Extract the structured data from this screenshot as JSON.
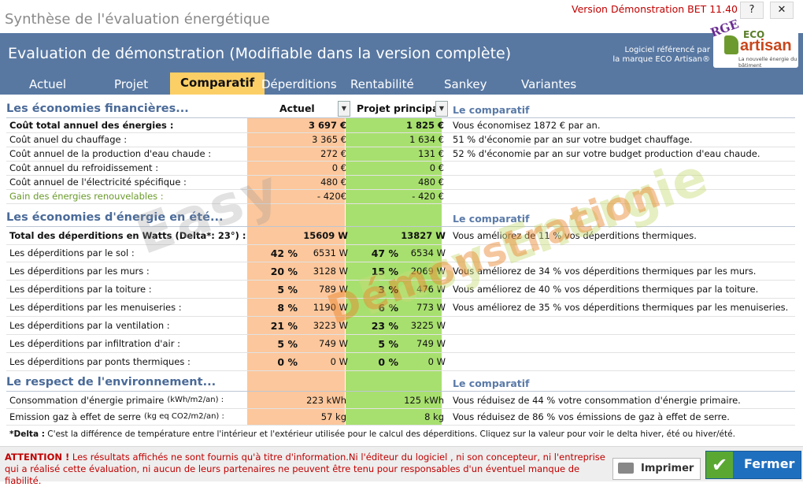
{
  "window": {
    "title": "Synthèse de l'évaluation énergétique",
    "version": "Version Démonstration BET 11.40",
    "help": "?",
    "close": "✕"
  },
  "header": {
    "title": "Evaluation de démonstration (Modifiable dans la version complète)",
    "ref_line1": "Logiciel référencé par",
    "ref_line2": "la marque ECO Artisan®",
    "logo": {
      "rge": "RGE",
      "eco": "ECO",
      "artisan": "artisan",
      "tagline": "La nouvelle énergie du bâtiment"
    }
  },
  "tabs": [
    {
      "label": "Actuel"
    },
    {
      "label": "Projet"
    },
    {
      "label": "Comparatif",
      "active": true
    },
    {
      "label": "Déperditions"
    },
    {
      "label": "Rentabilité"
    },
    {
      "label": "Sankey"
    },
    {
      "label": "Variantes"
    }
  ],
  "columns": {
    "actuel": "Actuel",
    "projet": "Projet principal",
    "comparatif": "Le comparatif"
  },
  "finance": {
    "title": "Les économies financières...",
    "rows": [
      {
        "label": "Coût total annuel des énergies :",
        "a": "3 697 €",
        "b": "1 825 €",
        "note": "Vous économisez 1872 € par an."
      },
      {
        "label": "Coût anuel du chauffage :",
        "a": "3 365 €",
        "b": "1 634 €",
        "note": "51 % d'économie par an sur votre budget chauffage."
      },
      {
        "label": "Coût annuel de la production d'eau chaude :",
        "a": "272 €",
        "b": "131 €",
        "note": "52 % d'économie par an sur votre budget production d'eau chaude."
      },
      {
        "label": "Coût annuel du refroidissement :",
        "a": "0 €",
        "b": "0 €",
        "note": ""
      },
      {
        "label": "Coût annuel de l'électricité spécifique :",
        "a": "480 €",
        "b": "480 €",
        "note": ""
      },
      {
        "label": "Gain des énergies renouvelables :",
        "a": "- 420€",
        "b": "- 420 €",
        "note": ""
      }
    ]
  },
  "energy": {
    "title": "Les économies d'énergie en été...",
    "rows": [
      {
        "label": "Total des déperditions en Watts (Delta*: 23°) :",
        "pa": "",
        "a": "15609 W",
        "pb": "",
        "b": "13827 W",
        "note": "Vous améliorez de 11 % vos déperditions thermiques."
      },
      {
        "label": "Les déperditions par le sol :",
        "pa": "42 %",
        "a": "6531 W",
        "pb": "47 %",
        "b": "6534 W",
        "note": ""
      },
      {
        "label": "Les déperditions par les murs :",
        "pa": "20 %",
        "a": "3128 W",
        "pb": "15 %",
        "b": "2069 W",
        "note": "Vous améliorez de 34 % vos déperditions thermiques par les murs."
      },
      {
        "label": "Les déperditions par la toiture :",
        "pa": "5 %",
        "a": "789 W",
        "pb": "3 %",
        "b": "476 W",
        "note": "Vous améliorez de 40 % vos déperditions thermiques par la toiture."
      },
      {
        "label": "Les déperditions par les menuiseries :",
        "pa": "8 %",
        "a": "1190 W",
        "pb": "6 %",
        "b": "773 W",
        "note": "Vous améliorez de 35 % vos déperditions thermiques par les menuiseries."
      },
      {
        "label": "Les déperditions par la ventilation :",
        "pa": "21 %",
        "a": "3223 W",
        "pb": "23 %",
        "b": "3225 W",
        "note": ""
      },
      {
        "label": "Les déperditions par infiltration d'air :",
        "pa": "5 %",
        "a": "749 W",
        "pb": "5 %",
        "b": "749 W",
        "note": ""
      },
      {
        "label": "Les déperditions par ponts thermiques :",
        "pa": "0 %",
        "a": "0 W",
        "pb": "0 %",
        "b": "0 W",
        "note": ""
      }
    ]
  },
  "environment": {
    "title": "Le respect de l'environnement...",
    "rows": [
      {
        "label": "Consommation d'énergie primaire",
        "unit": "(kWh/m2/an) :",
        "a": "223 kWh",
        "b": "125 kWh",
        "note": "Vous réduisez de 44 % votre consommation d'énergie primaire."
      },
      {
        "label": "Emission gaz à effet de serre",
        "unit": "(kg eq CO2/m2/an) :",
        "a": "57 kg",
        "b": "8 kg",
        "note": "Vous réduisez de 86 % vos émissions de gaz à effet de serre."
      }
    ]
  },
  "footnote": {
    "key": "*Delta :",
    "text": "C'est la différence de température entre l'intérieur et l'extérieur utilisée pour le calcul des déperditions. Cliquez sur la valeur pour voir le delta hiver, été ou hiver/été."
  },
  "warning": {
    "key": "ATTENTION !",
    "text": "Les résultats affichés ne sont fournis qu'à titre d'information.Ni l'éditeur du logiciel , ni son concepteur, ni l'entreprise qui a réalisé cette évaluation, ni aucun de leurs partenaires ne peuvent être tenu pour responsables d'un éventuel manque de fiabilité."
  },
  "buttons": {
    "print": "Imprimer",
    "close": "Fermer"
  },
  "watermark": {
    "line1": "Easy Energie",
    "line2": "Démonstration"
  },
  "colors": {
    "header": "#5878a2",
    "tab_active": "#fbcf66",
    "actuel_col": "#fcc79c",
    "projet_col": "#a8e06f",
    "warning": "#c00000"
  }
}
